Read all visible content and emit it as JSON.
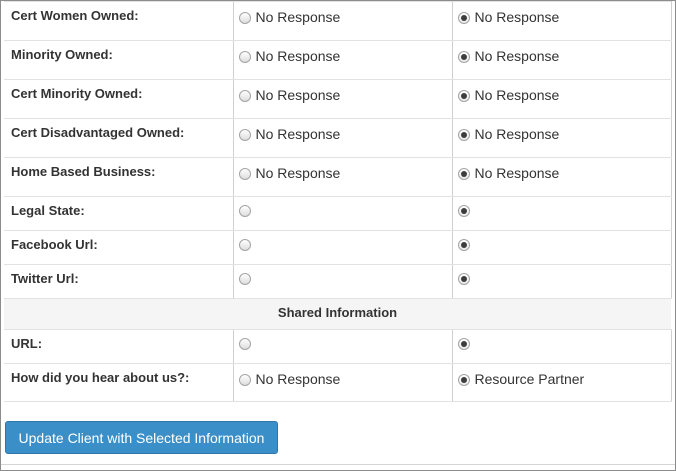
{
  "rows": [
    {
      "label": "Cert Women Owned:",
      "left": {
        "text": "No Response",
        "checked": false
      },
      "right": {
        "text": "No Response",
        "checked": true
      }
    },
    {
      "label": "Minority Owned:",
      "left": {
        "text": "No Response",
        "checked": false
      },
      "right": {
        "text": "No Response",
        "checked": true
      }
    },
    {
      "label": "Cert Minority Owned:",
      "left": {
        "text": "No Response",
        "checked": false
      },
      "right": {
        "text": "No Response",
        "checked": true
      }
    },
    {
      "label": "Cert Disadvantaged Owned:",
      "left": {
        "text": "No Response",
        "checked": false
      },
      "right": {
        "text": "No Response",
        "checked": true
      }
    },
    {
      "label": "Home Based Business:",
      "left": {
        "text": "No Response",
        "checked": false
      },
      "right": {
        "text": "No Response",
        "checked": true
      }
    },
    {
      "label": "Legal State:",
      "left": {
        "text": "",
        "checked": false
      },
      "right": {
        "text": "",
        "checked": true
      }
    },
    {
      "label": "Facebook Url:",
      "left": {
        "text": "",
        "checked": false
      },
      "right": {
        "text": "",
        "checked": true
      }
    },
    {
      "label": "Twitter Url:",
      "left": {
        "text": "",
        "checked": false
      },
      "right": {
        "text": "",
        "checked": true
      }
    }
  ],
  "section_title": "Shared Information",
  "shared_rows": [
    {
      "label": "URL:",
      "left": {
        "text": "",
        "checked": false
      },
      "right": {
        "text": "",
        "checked": true
      }
    },
    {
      "label": "How did you hear about us?:",
      "left": {
        "text": "No Response",
        "checked": false
      },
      "right": {
        "text": "Resource Partner",
        "checked": true
      }
    }
  ],
  "button_label": "Update Client with Selected Information",
  "colors": {
    "button_bg": "#3b8fc8",
    "section_bg": "#f5f5f5",
    "text": "#333333"
  }
}
